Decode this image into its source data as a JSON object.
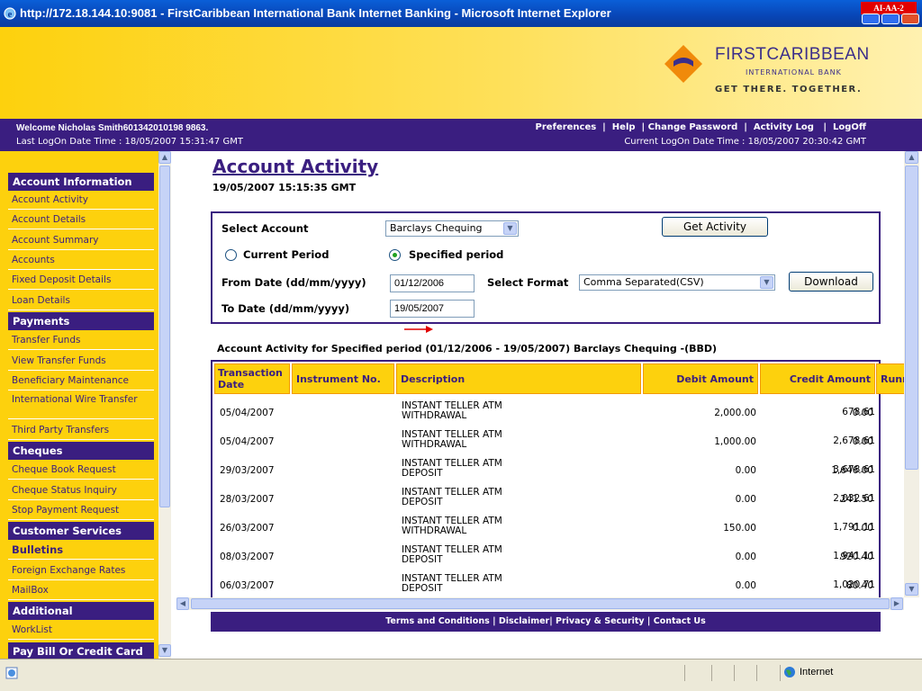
{
  "window": {
    "title": "http://172.18.144.10:9081 - FirstCaribbean International Bank Internet Banking - Microsoft Internet Explorer",
    "badge": "AI-AA-2"
  },
  "logo": {
    "brand": "FIRSTCARIBBEAN",
    "sub": "INTERNATIONAL BANK",
    "tagline": "GET THERE. TOGETHER."
  },
  "infobar": {
    "welcome": "Welcome Nicholas Smith601342010198 9863.",
    "last_logon": "Last LogOn Date Time : 18/05/2007 15:31:47 GMT",
    "links": [
      "Preferences",
      "Help",
      "Change Password",
      "Activity Log",
      "LogOff"
    ],
    "current_logon": "Current LogOn Date Time : 18/05/2007 20:30:42 GMT"
  },
  "nav": {
    "s1": "Account Information",
    "i1": "Account Activity",
    "i2": "Account Details",
    "i3": "Account Summary",
    "i4": "Accounts",
    "i5": "Fixed Deposit Details",
    "i6": "Loan Details",
    "s2": "Payments",
    "i7": "Transfer Funds",
    "i8": "View Transfer Funds",
    "i9": "Beneficiary Maintenance",
    "i10": "International Wire Transfer",
    "i11": "Third Party Transfers",
    "s3": "Cheques",
    "i12": "Cheque Book Request",
    "i13": "Cheque Status Inquiry",
    "i14": "Stop Payment Request",
    "s4": "Customer Services",
    "s5": "Bulletins",
    "i15": "Foreign Exchange Rates",
    "i16": "MailBox",
    "s6": "Additional",
    "i17": "WorkList",
    "s7": "Pay Bill Or Credit Card"
  },
  "page": {
    "title": "Account Activity",
    "datetime": "19/05/2007 15:15:35 GMT"
  },
  "form": {
    "select_account_label": "Select Account",
    "account_value": "Barclays Chequing",
    "get_activity": "Get Activity",
    "current_period": "Current Period",
    "specified_period": "Specified period",
    "from_label": "From Date (dd/mm/yyyy)",
    "from_value": "01/12/2006",
    "format_label": "Select Format",
    "format_value": "Comma Separated(CSV)",
    "download": "Download",
    "to_label": "To Date (dd/mm/yyyy)",
    "to_value": "19/05/2007"
  },
  "results": {
    "heading": "Account Activity for Specified period (01/12/2006 - 19/05/2007) Barclays Chequing -(BBD)",
    "columns": [
      "Transaction Date",
      "Instrument No.",
      "Description",
      "Debit Amount",
      "Credit Amount",
      "Running Balance"
    ],
    "rows": [
      {
        "date": "05/04/2007",
        "inst": "",
        "desc": "INSTANT TELLER ATM WITHDRAWAL",
        "debit": "2,000.00",
        "credit": "0.00",
        "balance": "678.61"
      },
      {
        "date": "05/04/2007",
        "inst": "",
        "desc": "INSTANT TELLER ATM WITHDRAWAL",
        "debit": "1,000.00",
        "credit": "0.00",
        "balance": "2,678.61"
      },
      {
        "date": "29/03/2007",
        "inst": "",
        "desc": "INSTANT TELLER ATM DEPOSIT",
        "debit": "0.00",
        "credit": "1,646.00",
        "balance": "3,678.61"
      },
      {
        "date": "28/03/2007",
        "inst": "",
        "desc": "INSTANT TELLER ATM DEPOSIT",
        "debit": "0.00",
        "credit": "241.50",
        "balance": "2,032.61"
      },
      {
        "date": "26/03/2007",
        "inst": "",
        "desc": "INSTANT TELLER ATM WITHDRAWAL",
        "debit": "150.00",
        "credit": "0.00",
        "balance": "1,791.11"
      },
      {
        "date": "08/03/2007",
        "inst": "",
        "desc": "INSTANT TELLER ATM DEPOSIT",
        "debit": "0.00",
        "credit": "920.40",
        "balance": "1,941.11"
      },
      {
        "date": "06/03/2007",
        "inst": "",
        "desc": "INSTANT TELLER ATM DEPOSIT",
        "debit": "0.00",
        "credit": "80.40",
        "balance": "1,020.71"
      }
    ]
  },
  "footer": {
    "links": [
      "Terms and Conditions",
      "Disclaimer",
      "Privacy & Security",
      "Contact Us"
    ]
  },
  "status": {
    "zone": "Internet"
  },
  "colors": {
    "brand_purple": "#3a1e80",
    "brand_yellow": "#fdd10d",
    "header_border": "#f29a00"
  }
}
